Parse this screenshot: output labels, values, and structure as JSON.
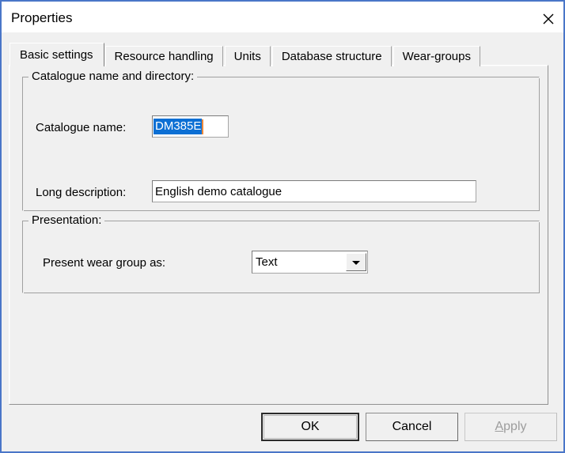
{
  "window": {
    "title": "Properties",
    "close_icon": "close-icon",
    "border_color": "#4a76c8"
  },
  "tabs": [
    {
      "label": "Basic settings",
      "selected": true
    },
    {
      "label": "Resource handling",
      "selected": false
    },
    {
      "label": "Units",
      "selected": false
    },
    {
      "label": "Database structure",
      "selected": false
    },
    {
      "label": "Wear-groups",
      "selected": false
    }
  ],
  "groups": {
    "catalogue": {
      "title": "Catalogue name and directory:",
      "catalogue_name_label": "Catalogue name:",
      "catalogue_name_value": "DM385E",
      "catalogue_name_selected": true,
      "selection_color": "#0c6fd4",
      "caret_color": "#ef8a3a",
      "long_description_label": "Long description:",
      "long_description_value": "English demo catalogue"
    },
    "presentation": {
      "title": "Presentation:",
      "wear_group_label": "Present wear group as:",
      "wear_group_value": "Text",
      "wear_group_options": [
        "Text"
      ],
      "dropdown_icon": "chevron-down-icon"
    }
  },
  "buttons": {
    "ok": {
      "label": "OK",
      "default": true,
      "enabled": true
    },
    "cancel": {
      "label": "Cancel",
      "default": false,
      "enabled": true
    },
    "apply": {
      "label_accel": "A",
      "label_rest": "pply",
      "default": false,
      "enabled": false
    }
  }
}
